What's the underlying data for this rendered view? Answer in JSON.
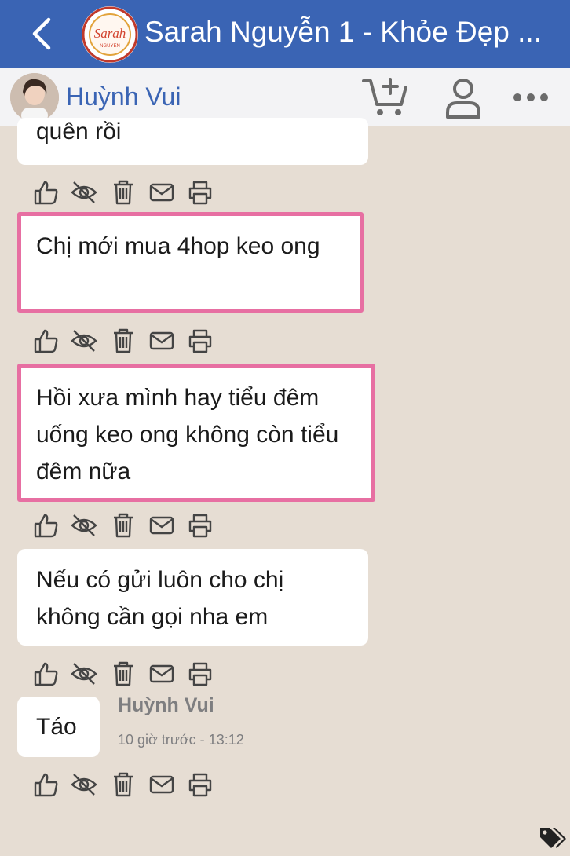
{
  "header": {
    "title": "Sarah Nguyễn 1 - Khỏe Đẹp ...",
    "logo_text": "Sarah",
    "logo_subtext": "NGUYEN",
    "back_icon": "chevron-left-icon"
  },
  "subbar": {
    "contact_name": "Huỳnh Vui",
    "icons": [
      "add-to-cart-icon",
      "person-icon",
      "more-icon"
    ]
  },
  "messages": [
    {
      "text": "quên rồi",
      "highlighted": false
    },
    {
      "text": "Chị mới mua 4hop keo ong",
      "highlighted": true
    },
    {
      "text": "Hồi xưa mình hay tiểu đêm uống keo ong không còn tiểu đêm nữa",
      "highlighted": true
    },
    {
      "text": "Nếu có gửi luôn cho chị không cần gọi nha em",
      "highlighted": false
    },
    {
      "text": "Táo",
      "highlighted": false
    }
  ],
  "last_message_meta": {
    "sender": "Huỳnh Vui",
    "time": "10 giờ trước - 13:12"
  },
  "message_actions": [
    "like-icon",
    "hide-icon",
    "trash-icon",
    "mail-icon",
    "print-icon"
  ],
  "colors": {
    "header_bg": "#3a64b4",
    "chat_bg": "#e6ddd3",
    "highlight_border": "#e76fa2",
    "contact_name": "#3a64b4"
  }
}
